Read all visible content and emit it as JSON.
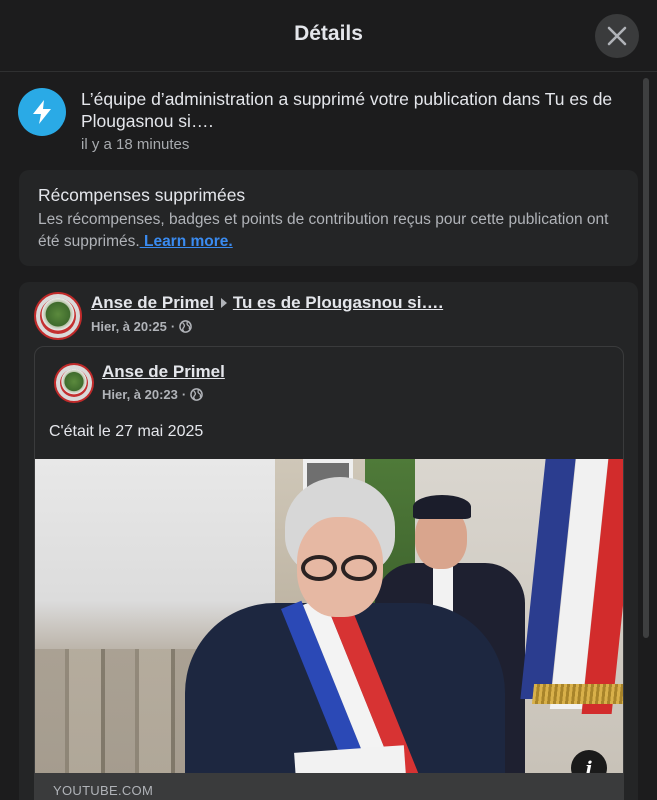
{
  "header": {
    "title": "Détails"
  },
  "notification": {
    "text": "L’équipe d’administration a supprimé votre publication dans Tu es de Plougasnou si….",
    "time": "il y a 18 minutes",
    "icon": "lightning-icon"
  },
  "rewards": {
    "title": "Récompenses supprimées",
    "description": "Les récompenses, badges et points de contribution reçus pour cette publication ont été supprimés.",
    "link": " Learn more."
  },
  "post": {
    "author": "Anse de Primel",
    "group": "Tu es de Plougasnou si….",
    "time": "Hier, à 20:25",
    "separator": "·",
    "shared": {
      "author": "Anse de Primel",
      "time": "Hier, à 20:23",
      "separator": "·",
      "caption": "C'était le 27 mai 2025",
      "domain": "YOUTUBE.COM"
    }
  },
  "colors": {
    "accent": "#3a8bf0",
    "background": "#1c1c1d",
    "card": "#242526",
    "notif_icon": "#2aaae6"
  }
}
